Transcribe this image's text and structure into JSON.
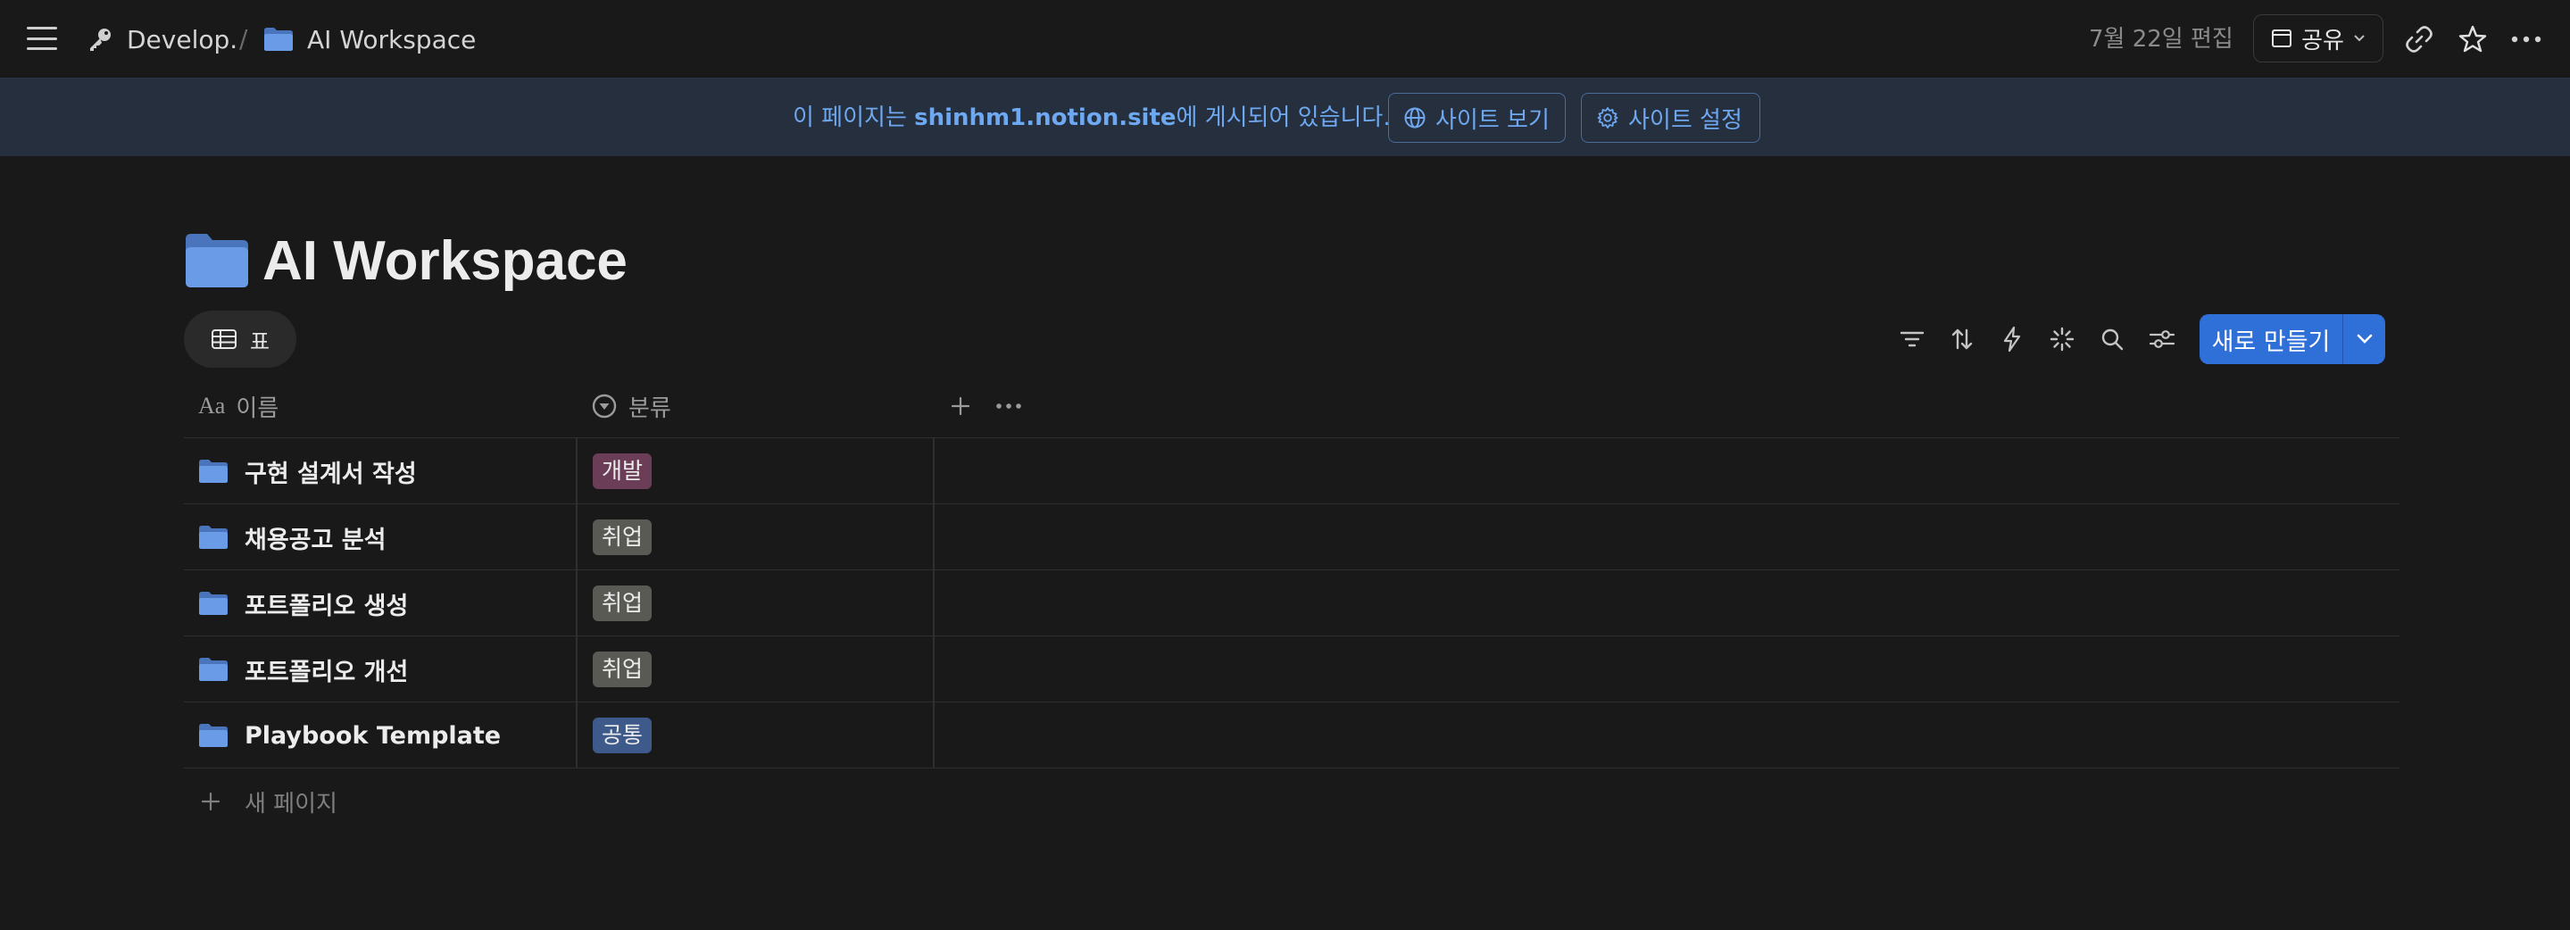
{
  "topbar": {
    "breadcrumb": [
      {
        "label": "Develop.",
        "icon": "key-icon"
      },
      {
        "label": "AI Workspace",
        "icon": "folder-icon"
      }
    ],
    "separator": "/",
    "edited": "7월 22일 편집",
    "share_label": "공유"
  },
  "banner": {
    "text_prefix": "이 페이지는 ",
    "site": "shinhm1.notion.site",
    "text_suffix": "에 게시되어 있습니다.",
    "view_site": "사이트 보기",
    "site_settings": "사이트 설정"
  },
  "page": {
    "title": "AI Workspace"
  },
  "view": {
    "tab_label": "표",
    "new_button": "새로 만들기"
  },
  "table": {
    "columns": [
      {
        "label": "이름",
        "icon": "Aa"
      },
      {
        "label": "분류",
        "icon": "select-icon"
      }
    ],
    "rows": [
      {
        "name": "구현 설계서 작성",
        "category": "개발"
      },
      {
        "name": "채용공고 분석",
        "category": "취업"
      },
      {
        "name": "포트폴리오 생성",
        "category": "취업"
      },
      {
        "name": "포트폴리오 개선",
        "category": "취업"
      },
      {
        "name": "Playbook Template",
        "category": "공통"
      }
    ],
    "new_page": "새 페이지"
  },
  "colors": {
    "background": "#191919",
    "banner_bg": "#252f3e",
    "banner_text": "#6ea8f0",
    "accent": "#2f6fd8",
    "tag_dev": "#6b3d57",
    "tag_job": "#5a5a55",
    "tag_common": "#3e5a8a",
    "folder": "#5b8ad8"
  }
}
